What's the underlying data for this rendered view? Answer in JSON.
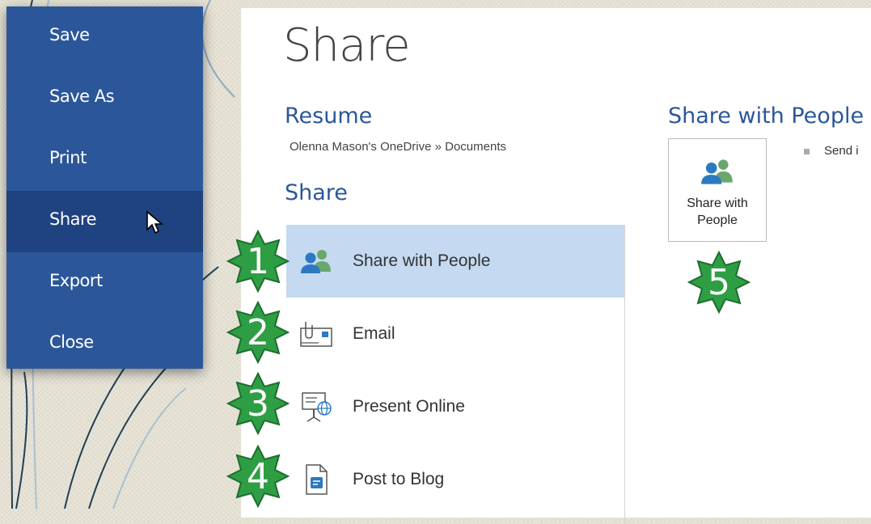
{
  "menu": {
    "items": [
      {
        "label": "Save"
      },
      {
        "label": "Save As"
      },
      {
        "label": "Print"
      },
      {
        "label": "Share"
      },
      {
        "label": "Export"
      },
      {
        "label": "Close"
      }
    ]
  },
  "page": {
    "title": "Share",
    "document_title": "Resume",
    "document_path": "Olenna Mason's OneDrive » Documents",
    "share_heading": "Share"
  },
  "share_options": [
    {
      "label": "Share with People",
      "icon": "people-icon"
    },
    {
      "label": "Email",
      "icon": "email-icon"
    },
    {
      "label": "Present Online",
      "icon": "present-online-icon"
    },
    {
      "label": "Post to Blog",
      "icon": "blog-icon"
    }
  ],
  "detail": {
    "heading": "Share with People",
    "button_label_line1": "Share with",
    "button_label_line2": "People",
    "bullet_text": "Send i"
  },
  "callouts": [
    "1",
    "2",
    "3",
    "4",
    "5"
  ],
  "colors": {
    "menu_bg": "#2b579a",
    "menu_active": "#1f4280",
    "accent_text": "#2b579a",
    "selected_option": "#c5d9f1",
    "callout_green": "#2e9e44"
  }
}
